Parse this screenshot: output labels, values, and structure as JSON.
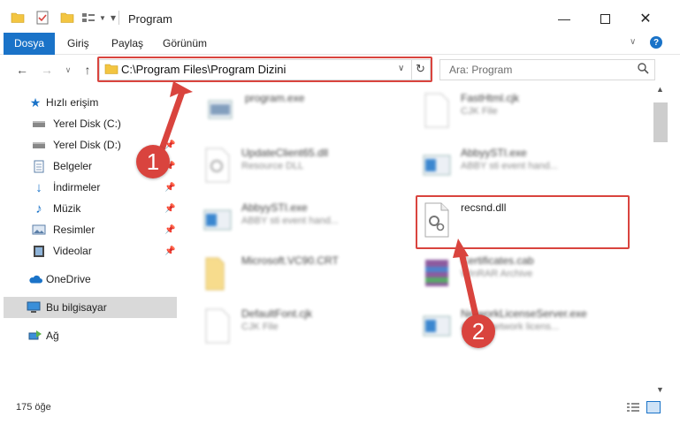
{
  "window": {
    "title": "Program",
    "minimize_icon": "minimize-icon",
    "maximize_icon": "maximize-icon",
    "close_icon": "close-icon"
  },
  "ribbon": {
    "tabs": [
      "Dosya",
      "Giriş",
      "Paylaş",
      "Görünüm"
    ]
  },
  "address": {
    "path": "C:\\Program Files\\Program Dizini"
  },
  "search": {
    "placeholder": "Ara: Program"
  },
  "nav": {
    "items": [
      {
        "label": "Hızlı erişim",
        "icon": "star-icon"
      },
      {
        "label": "Yerel Disk (C:)",
        "icon": "drive-icon"
      },
      {
        "label": "Yerel Disk (D:)",
        "icon": "drive-icon"
      },
      {
        "label": "Belgeler",
        "icon": "document-icon"
      },
      {
        "label": "İndirmeler",
        "icon": "download-icon"
      },
      {
        "label": "Müzik",
        "icon": "music-icon"
      },
      {
        "label": "Resimler",
        "icon": "pictures-icon"
      },
      {
        "label": "Videolar",
        "icon": "video-icon"
      },
      {
        "label": "OneDrive",
        "icon": "cloud-icon"
      },
      {
        "label": "Bu bilgisayar",
        "icon": "computer-icon"
      },
      {
        "label": "Ağ",
        "icon": "network-icon"
      }
    ]
  },
  "files": [
    {
      "name": "program.exe",
      "sub": ""
    },
    {
      "name": "FastHtml.cjk",
      "sub": "CJK File"
    },
    {
      "name": "UpdateClient65.dll",
      "sub": "Resource DLL"
    },
    {
      "name": "AbbyySTI.exe",
      "sub": "ABBY sti event hand..."
    },
    {
      "name": "AbbyySTI.exe",
      "sub": "ABBY sti event hand..."
    },
    {
      "name": "recsnd.dll",
      "sub": ""
    },
    {
      "name": "Microsoft.VC90.CRT",
      "sub": ""
    },
    {
      "name": "Certificates.cab",
      "sub": "WinRAR Archive"
    },
    {
      "name": "DefaultFont.cjk",
      "sub": "CJK File"
    },
    {
      "name": "NetworkLicenseServer.exe",
      "sub": "ABBY network licens..."
    }
  ],
  "status": {
    "count": "175 öğe"
  },
  "annotations": {
    "badge1": "1",
    "badge2": "2"
  },
  "colors": {
    "accent": "#1a73c8",
    "highlight": "#d9443e",
    "selection": "#d9d9d9"
  }
}
